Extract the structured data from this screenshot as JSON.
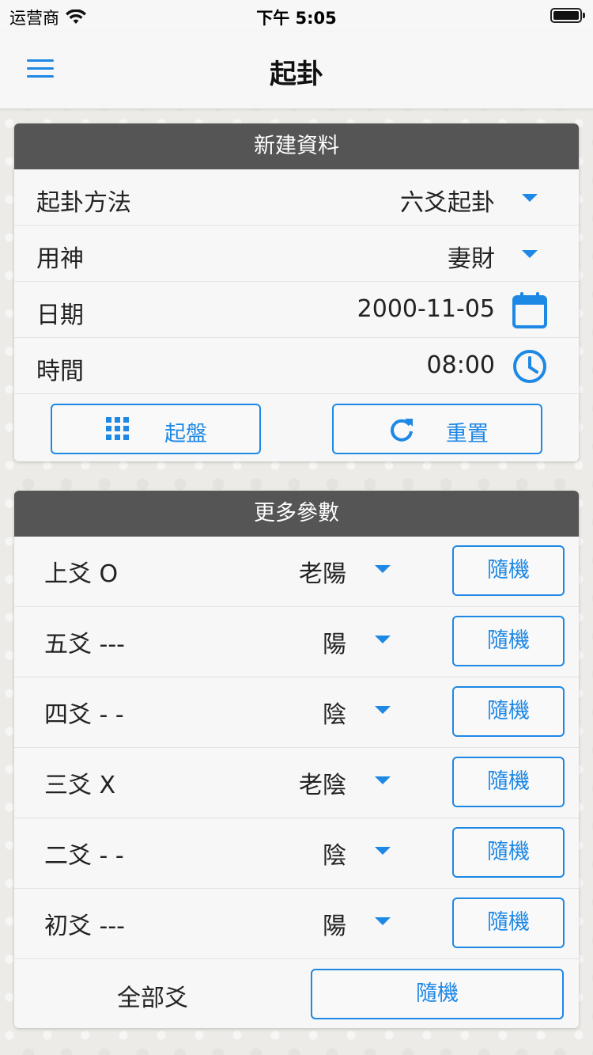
{
  "status_bar": {
    "carrier": "运营商",
    "time": "下午 5:05"
  },
  "nav": {
    "title": "起卦",
    "menu_icon": "hamburger-menu-icon"
  },
  "new_record": {
    "header": "新建資料",
    "method": {
      "label": "起卦方法",
      "value": "六爻起卦"
    },
    "god": {
      "label": "用神",
      "value": "妻財"
    },
    "date": {
      "label": "日期",
      "value": "2000-11-05",
      "icon": "calendar-icon"
    },
    "time": {
      "label": "時間",
      "value": "08:00",
      "icon": "clock-icon"
    },
    "start_button": {
      "label": "起盤",
      "icon": "grid-icon"
    },
    "reset_button": {
      "label": "重置",
      "icon": "refresh-icon"
    }
  },
  "more_params": {
    "header": "更多參數",
    "yao": [
      {
        "label": "上爻 O",
        "value": "老陽",
        "button": "隨機"
      },
      {
        "label": "五爻 ---",
        "value": "陽",
        "button": "隨機"
      },
      {
        "label": "四爻 - -",
        "value": "陰",
        "button": "隨機"
      },
      {
        "label": "三爻 X",
        "value": "老陰",
        "button": "隨機"
      },
      {
        "label": "二爻 - -",
        "value": "陰",
        "button": "隨機"
      },
      {
        "label": "初爻 ---",
        "value": "陽",
        "button": "隨機"
      }
    ],
    "all": {
      "label": "全部爻",
      "button": "隨機"
    }
  },
  "colors": {
    "accent": "#1e88e5",
    "header_bg": "#555555",
    "card_bg": "#f7f7f7"
  }
}
